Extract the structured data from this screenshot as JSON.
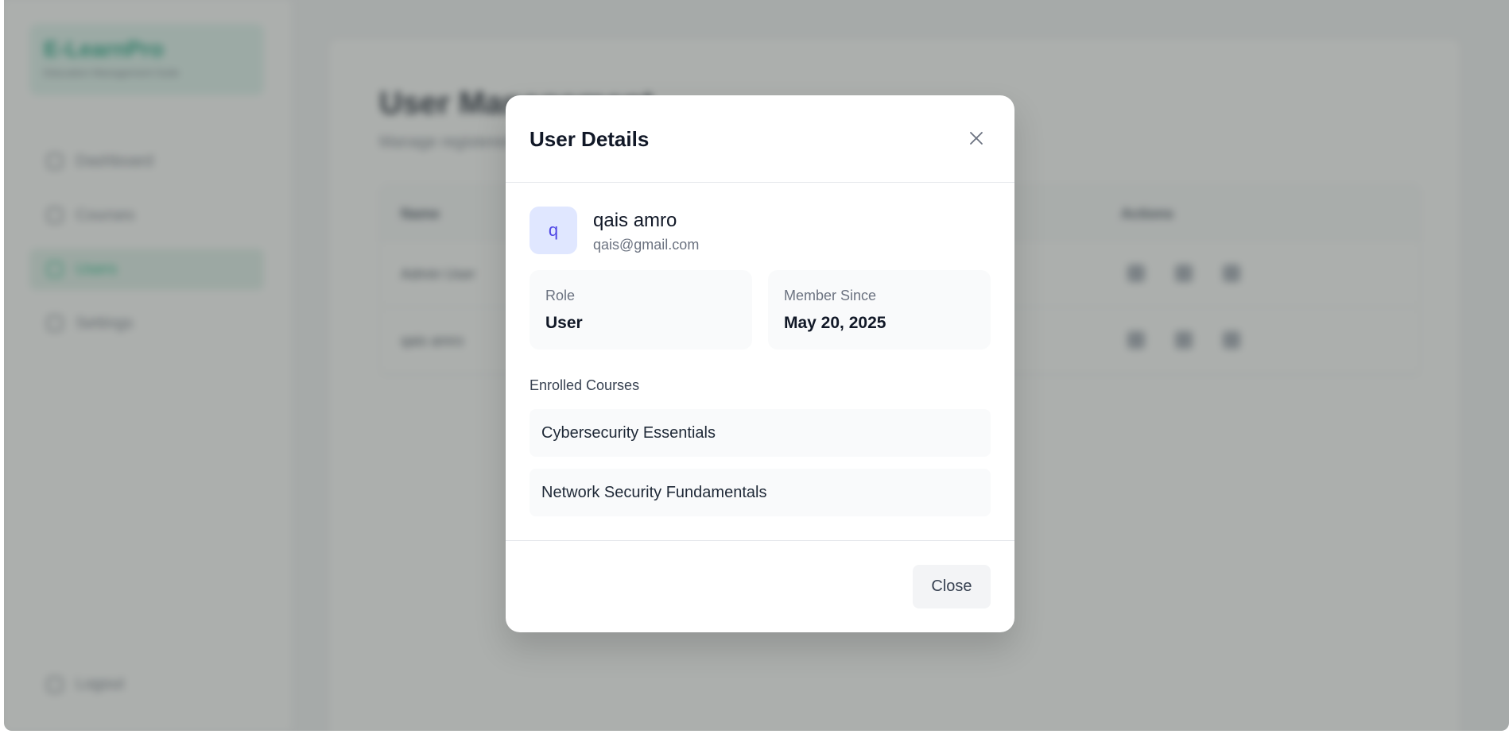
{
  "background": {
    "brand": {
      "name": "E-LearnPro",
      "subtitle": "Education Management Suite"
    },
    "nav": [
      {
        "label": "Dashboard",
        "active": false
      },
      {
        "label": "Courses",
        "active": false
      },
      {
        "label": "Users",
        "active": true
      },
      {
        "label": "Settings",
        "active": false
      }
    ],
    "logout_label": "Logout",
    "page_title": "User Management",
    "page_subtitle": "Manage registered users",
    "table": {
      "columns": [
        "Name",
        "Actions"
      ],
      "rows": [
        {
          "name": "Admin User"
        },
        {
          "name": "qais amro"
        }
      ]
    }
  },
  "modal": {
    "title": "User Details",
    "user": {
      "initial": "q",
      "name": "qais amro",
      "email": "qais@gmail.com"
    },
    "role": {
      "label": "Role",
      "value": "User"
    },
    "member_since": {
      "label": "Member Since",
      "value": "May 20, 2025"
    },
    "enrolled_label": "Enrolled Courses",
    "courses": [
      "Cybersecurity Essentials",
      "Network Security Fundamentals"
    ],
    "close_label": "Close"
  },
  "colors": {
    "accent": "#10b981",
    "avatar_bg": "#e0e7ff",
    "avatar_text": "#4f46e5"
  }
}
